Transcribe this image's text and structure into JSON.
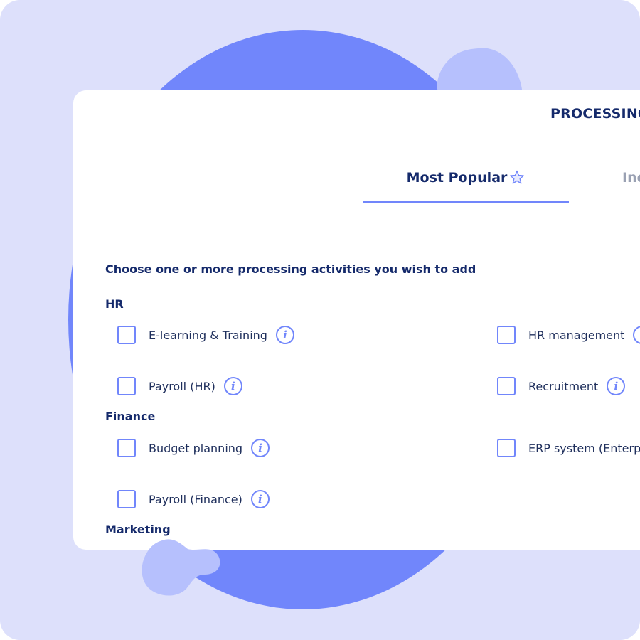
{
  "card": {
    "title": "PROCESSING",
    "tabs": [
      {
        "label": "Most Popular",
        "active": true
      },
      {
        "label": "Inc",
        "active": false
      }
    ],
    "prompt": "Choose one or more processing activities you wish to add"
  },
  "groups": [
    {
      "title": "HR",
      "options": [
        {
          "label": "E-learning & Training"
        },
        {
          "label": "HR management"
        },
        {
          "label": "Payroll (HR)"
        },
        {
          "label": "Recruitment"
        }
      ]
    },
    {
      "title": "Finance",
      "options": [
        {
          "label": "Budget planning"
        },
        {
          "label": "ERP system (Enterp"
        },
        {
          "label": "Payroll (Finance)"
        }
      ]
    },
    {
      "title": "Marketing",
      "options": []
    }
  ],
  "icons": {
    "info_glyph": "i",
    "star": "star-outline-icon",
    "info": "info-icon"
  },
  "colors": {
    "background": "#dde0fb",
    "accent": "#7186fb",
    "blob": "#b6c0fd",
    "heading": "#152a6b",
    "muted_tab": "#9aa1b3"
  }
}
